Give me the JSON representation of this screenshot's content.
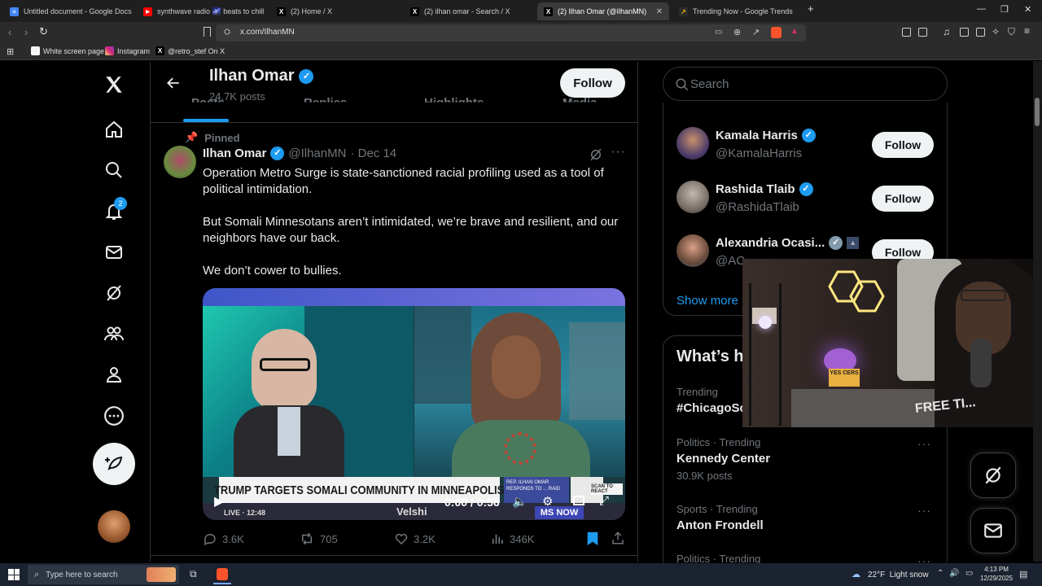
{
  "browser": {
    "tabs": [
      {
        "label": "Untitled document - Google Docs",
        "color": "#4285f4",
        "glyph": "≡"
      },
      {
        "label": "synthwave radio 🌌 beats to chill",
        "color": "#ff0000",
        "glyph": "▶"
      },
      {
        "label": "(2) Home / X",
        "color": "#000000",
        "glyph": "X"
      },
      {
        "label": "(2) ilhan omar - Search / X",
        "color": "#000000",
        "glyph": "X"
      },
      {
        "label": "(2) Ilhan Omar (@IlhanMN) / X",
        "color": "#000000",
        "glyph": "X"
      },
      {
        "label": "Trending Now - Google Trends",
        "color": "#f4b400",
        "glyph": "↗"
      }
    ],
    "new_tab_label": "+",
    "url": "x.com/IlhanMN",
    "bookmarks": [
      {
        "label": "White screen page",
        "color": "#f5f5f5"
      },
      {
        "label": "Instagram",
        "color": "#e1306c"
      },
      {
        "label": "@retro_stef On X",
        "color": "#000000"
      }
    ]
  },
  "profile": {
    "name": "Ilhan Omar",
    "posts_count": "24.7K posts",
    "follow_label": "Follow",
    "tabs": [
      "Posts",
      "Replies",
      "Highlights",
      "Media"
    ]
  },
  "nav": {
    "notifications_badge": "2"
  },
  "tweet": {
    "pinned_label": "Pinned",
    "author": "Ilhan Omar",
    "handle": "@IlhanMN",
    "date": "· Dec 14",
    "paragraphs": [
      "Operation Metro Surge is state-sanctioned racial profiling used as a tool of political intimidation.",
      "But Somali Minnesotans aren’t intimidated, we’re brave and resilient, and our neighbors have our back.",
      "We don’t cower to bullies."
    ],
    "video": {
      "chyron": "TRUMP TARGETS SOMALI COMMUNITY IN MINNEAPOLIS",
      "side_caption": "REP. ILHAN OMAR RESPONDS TO ... RAID",
      "scan_label": "SCAN TO REACT",
      "live_label": "LIVE · 12:48",
      "show_label": "Velshi",
      "network_label": "MS NOW",
      "time": "0:00 / 0:56"
    },
    "actions": {
      "replies": "3.6K",
      "reposts": "705",
      "likes": "3.2K",
      "views": "346K"
    }
  },
  "search": {
    "placeholder": "Search"
  },
  "who_to_follow": {
    "items": [
      {
        "name": "Kamala Harris",
        "handle": "@KamalaHarris",
        "follow": "Follow"
      },
      {
        "name": "Rashida Tlaib",
        "handle": "@RashidaTlaib",
        "follow": "Follow"
      },
      {
        "name": "Alexandria Ocasi...",
        "handle": "@AC",
        "follow": "Follow"
      }
    ],
    "show_more": "Show more"
  },
  "trending": {
    "title": "What’s h",
    "items": [
      {
        "meta": "Trending",
        "title": "#ChicagoSc",
        "count": ""
      },
      {
        "meta": "Politics · Trending",
        "title": "Kennedy Center",
        "count": "30.9K posts"
      },
      {
        "meta": "Sports · Trending",
        "title": "Anton Frondell",
        "count": ""
      },
      {
        "meta": "Politics · Trending",
        "title": "",
        "count": ""
      }
    ],
    "more_glyph": "···"
  },
  "webcam": {
    "sign_text": "YES CERS",
    "shirt_text": "FREE TI..."
  },
  "taskbar": {
    "search_placeholder": "Type here to search",
    "weather": "22°F  Light snow",
    "time": "4:13 PM",
    "date": "12/29/2025"
  }
}
